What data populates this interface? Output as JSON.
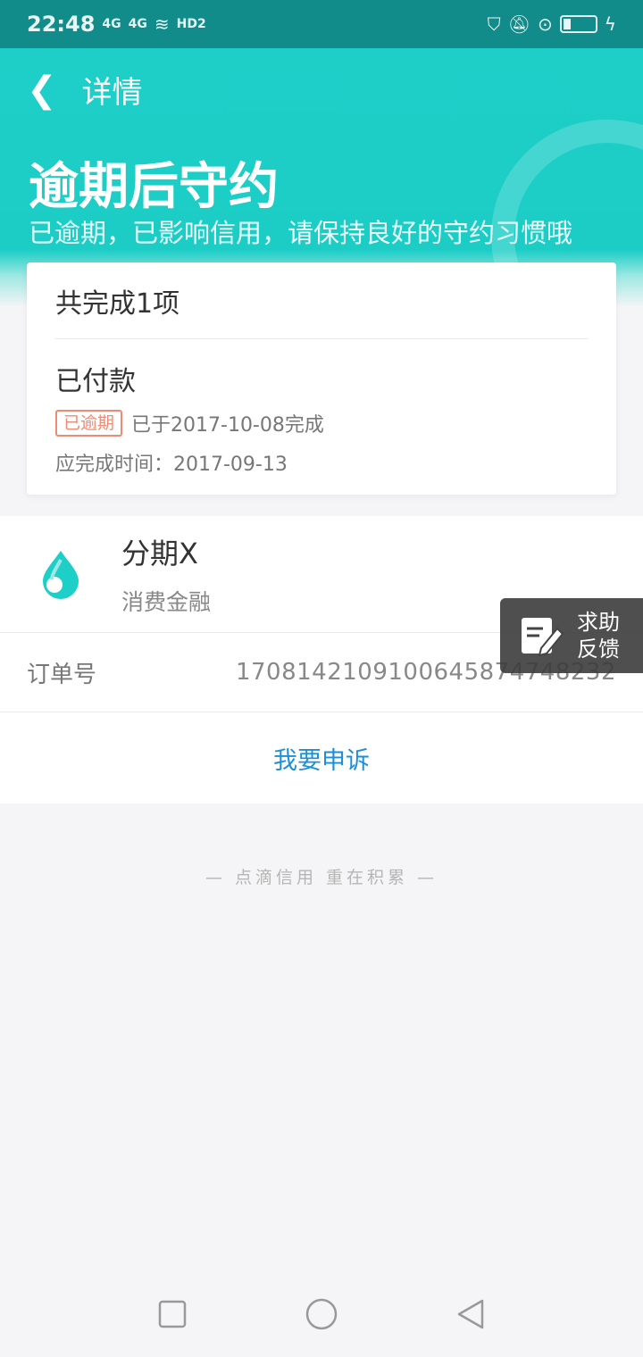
{
  "status_bar": {
    "time": "22:48",
    "signal1": "4G",
    "signal2": "4G",
    "hd": "HD2"
  },
  "header": {
    "back_icon": "chevron-left-icon",
    "nav_title": "详情",
    "hero_title": "逾期后守约",
    "hero_subtitle": "已逾期，已影响信用，请保持良好的守约习惯哦"
  },
  "summary_card": {
    "heading": "共完成1项",
    "item": {
      "title": "已付款",
      "badge": "已逾期",
      "completed_text": "已于2017-10-08完成",
      "due_text": "应完成时间：2017-09-13"
    }
  },
  "merchant": {
    "icon": "water-drop-icon",
    "name": "分期X",
    "category": "消费金融"
  },
  "order": {
    "label": "订单号",
    "value": "170814210910064587474823​2"
  },
  "appeal": {
    "label": "我要申诉"
  },
  "slogan": "— 点滴信用 重在积累 —",
  "help_button": {
    "icon": "edit-note-icon",
    "label": "求助反馈"
  },
  "colors": {
    "brand": "#1ecfc8",
    "link": "#1d8fd8",
    "overdue": "#f08a72"
  }
}
